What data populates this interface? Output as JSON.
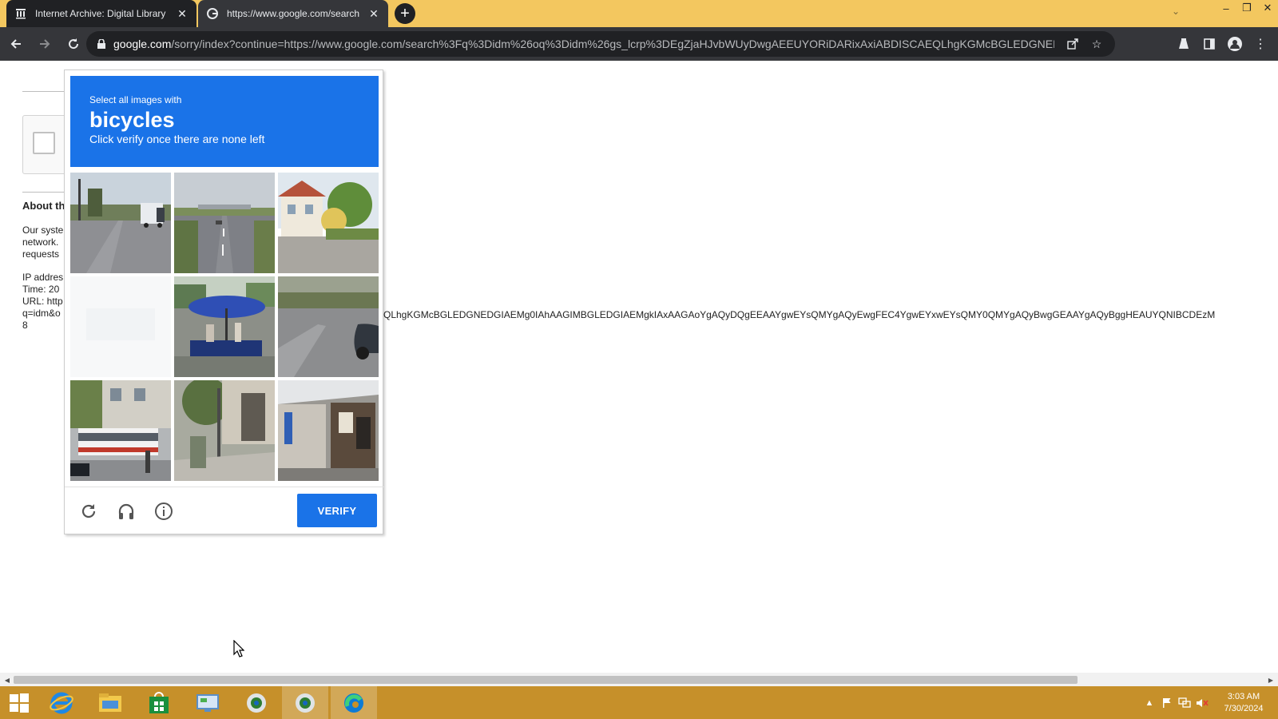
{
  "browser": {
    "tabs": [
      {
        "title": "Internet Archive: Digital Library",
        "favicon": "archive-icon",
        "active": false
      },
      {
        "title": "https://www.google.com/search",
        "favicon": "google-icon",
        "active": true
      }
    ],
    "url_host": "google.com",
    "url_rest": "/sorry/index?continue=https://www.google.com/search%3Fq%3Didm%26oq%3Didm%26gs_lcrp%3DEgZjaHJvbWUyDwgAEEUYORiDARixAxiABDISCAEQLhgKGMcBGLEDGNEDGIAEMg0IAhA..."
  },
  "page": {
    "about_title": "About th",
    "about_lines": "Our syste\nnetwork.\nrequests",
    "meta_lines": "IP addres\nTime: 20\nURL: http\nq=idm&o\n8",
    "long_url_text": "QLhgKGMcBGLEDGNEDGIAEMg0IAhAAGIMBGLEDGIAEMgkIAxAAGAoYgAQyDQgEEAAYgwEYsQMYgAQyEwgFEC4YgwEYxwEYsQMY0QMYgAQyBwgGEAAYgAQyBggHEAUYQNIBCDEzM"
  },
  "captcha": {
    "intro": "Select all images with",
    "target": "bicycles",
    "hint": "Click verify once there are none left",
    "verify_label": "VERIFY",
    "tiles": [
      {
        "scene": "highway-truck"
      },
      {
        "scene": "road-overpass"
      },
      {
        "scene": "house-trees"
      },
      {
        "scene": "blank-loading"
      },
      {
        "scene": "market-umbrella"
      },
      {
        "scene": "road-car-corner"
      },
      {
        "scene": "street-bus"
      },
      {
        "scene": "sidewalk-pole"
      },
      {
        "scene": "shop-front"
      }
    ]
  },
  "taskbar": {
    "time": "3:03 AM",
    "date": "7/30/2024"
  },
  "colors": {
    "accent": "#1a73e8",
    "tabbar": "#f3c75f",
    "taskbar": "#c6902a"
  }
}
